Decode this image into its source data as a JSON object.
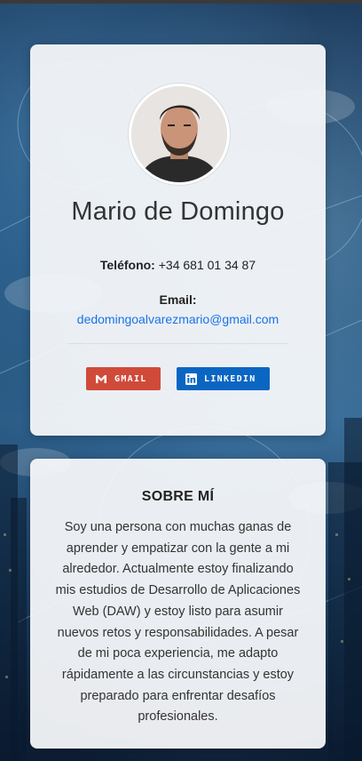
{
  "profile": {
    "name": "Mario de Domingo",
    "phone_label": "Teléfono:",
    "phone_value": "+34 681 01 34 87",
    "email_label": "Email:",
    "email_value": "dedomingoalvarezmario@gmail.com"
  },
  "buttons": {
    "gmail": "GMAIL",
    "linkedin": "LINKEDIN"
  },
  "about": {
    "title": "SOBRE MÍ",
    "text": "Soy una persona con muchas ganas de aprender y empatizar con la gente a mi alrededor. Actualmente estoy finalizando mis estudios de Desarrollo de Aplicaciones Web (DAW) y estoy listo para asumir nuevos retos y responsabilidades. A pesar de mi poca experiencia, me adapto rápidamente a las circunstancias y estoy preparado para enfrentar desafíos profesionales."
  },
  "colors": {
    "gmail_button": "#d04a3a",
    "linkedin_button": "#0a66c2",
    "email_link": "#1a73e8"
  },
  "icons": {
    "gmail": "gmail-icon",
    "linkedin": "linkedin-icon"
  }
}
